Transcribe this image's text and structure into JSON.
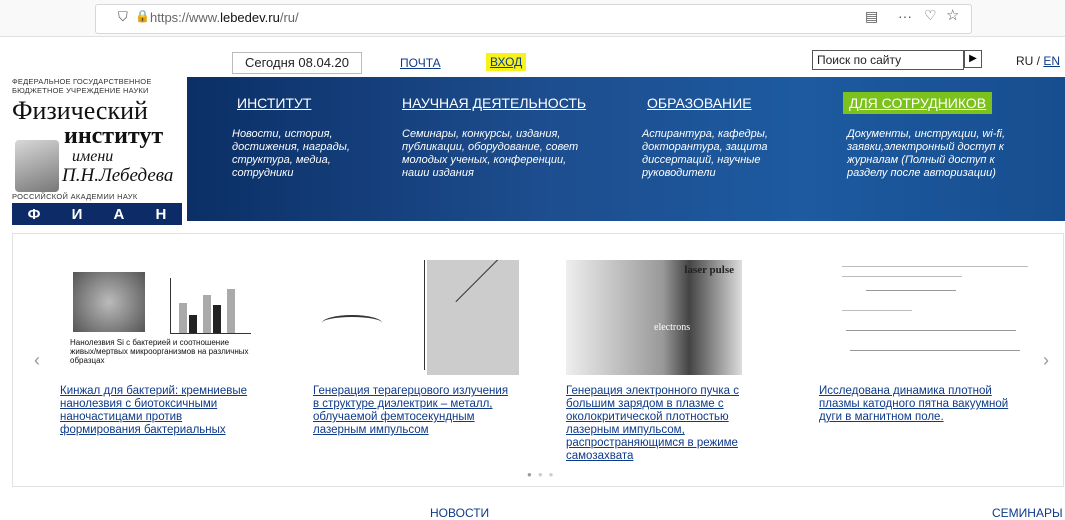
{
  "browser": {
    "url_prefix": "https://www.",
    "url_domain": "lebedev.ru",
    "url_suffix": "/ru/"
  },
  "topnav": {
    "today": "Сегодня 08.04.20",
    "mail": "ПОЧТА",
    "login": "ВХОД",
    "search_placeholder": "Поиск по сайту",
    "lang_ru": "RU / ",
    "lang_en": "EN"
  },
  "logo": {
    "top_line1": "ФЕДЕРАЛЬНОЕ ГОСУДАРСТВЕННОЕ",
    "top_line2": "БЮДЖЕТНОЕ УЧРЕЖДЕНИЕ НАУКИ",
    "w1": "Физический",
    "w2": "институт",
    "w3": "имени",
    "w4": "П.Н.Лебедева",
    "bottom": "РОССИЙСКОЙ АКАДЕМИИ НАУК",
    "f": "Ф",
    "i": "И",
    "a": "А",
    "n": "Н"
  },
  "menu": [
    {
      "title": "ИНСТИТУТ",
      "desc": "Новости, история, достижения, награды, структура, медиа, сотрудники"
    },
    {
      "title": "НАУЧНАЯ ДЕЯТЕЛЬНОСТЬ",
      "desc": "Семинары, конкурсы, издания, публикации, оборудование, совет молодых ученых, конференции, наши издания"
    },
    {
      "title": "ОБРАЗОВАНИЕ",
      "desc": "Аспирантура, кафедры, докторантура, защита диссертаций, научные руководители"
    },
    {
      "title": "ДЛЯ СОТРУДНИКОВ",
      "desc": "Документы, инструкции, wi-fi, заявки,электронный доступ к журналам (Полный доступ к разделу после авторизации)"
    }
  ],
  "slides": [
    {
      "caption": "Кинжал для бактерий: кремниевые нанолезвия с биотоксичными наночастицами против формирования бактериальных биопленок",
      "img_text": "Нанолезвия Si с бактерией и соотношение живых/мертвых микроорганизмов на различных образцах"
    },
    {
      "caption": "Генерация терагерцового излучения в структуре диэлектрик – металл, облучаемой фемтосекундным лазерным импульсом",
      "img_text": ""
    },
    {
      "caption": "Генерация электронного пучка с большим зарядом в плазме с околокритической плотностью лазерным импульсом, распространяющимся в режиме самозахвата",
      "img_text1": "laser pulse",
      "img_text2": "electrons"
    },
    {
      "caption": "Исследована динамика плотной плазмы катодного пятна вакуумной дуги в магнитном поле.",
      "img_text": ""
    }
  ],
  "bottom": {
    "news": "НОВОСТИ",
    "seminars": "СЕМИНАРЫ"
  }
}
